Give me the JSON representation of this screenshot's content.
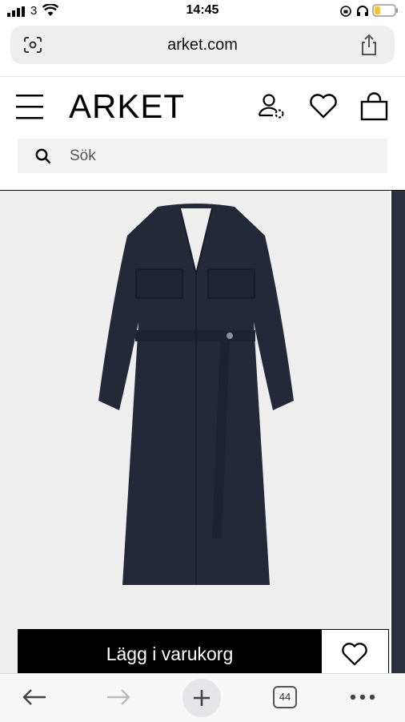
{
  "status_bar": {
    "carrier": "3",
    "time": "14:45"
  },
  "browser": {
    "url": "arket.com",
    "tab_count": "44"
  },
  "site": {
    "logo": "ARKET",
    "search_placeholder": "Sök"
  },
  "product": {
    "add_to_cart_label": "Lägg i varukorg",
    "color": "#232939"
  },
  "icons": [
    "menu-icon",
    "account-icon",
    "wishlist-icon",
    "bag-icon",
    "search-icon",
    "share-icon",
    "lens-icon",
    "back-icon",
    "forward-icon",
    "new-tab-icon",
    "more-icon"
  ]
}
